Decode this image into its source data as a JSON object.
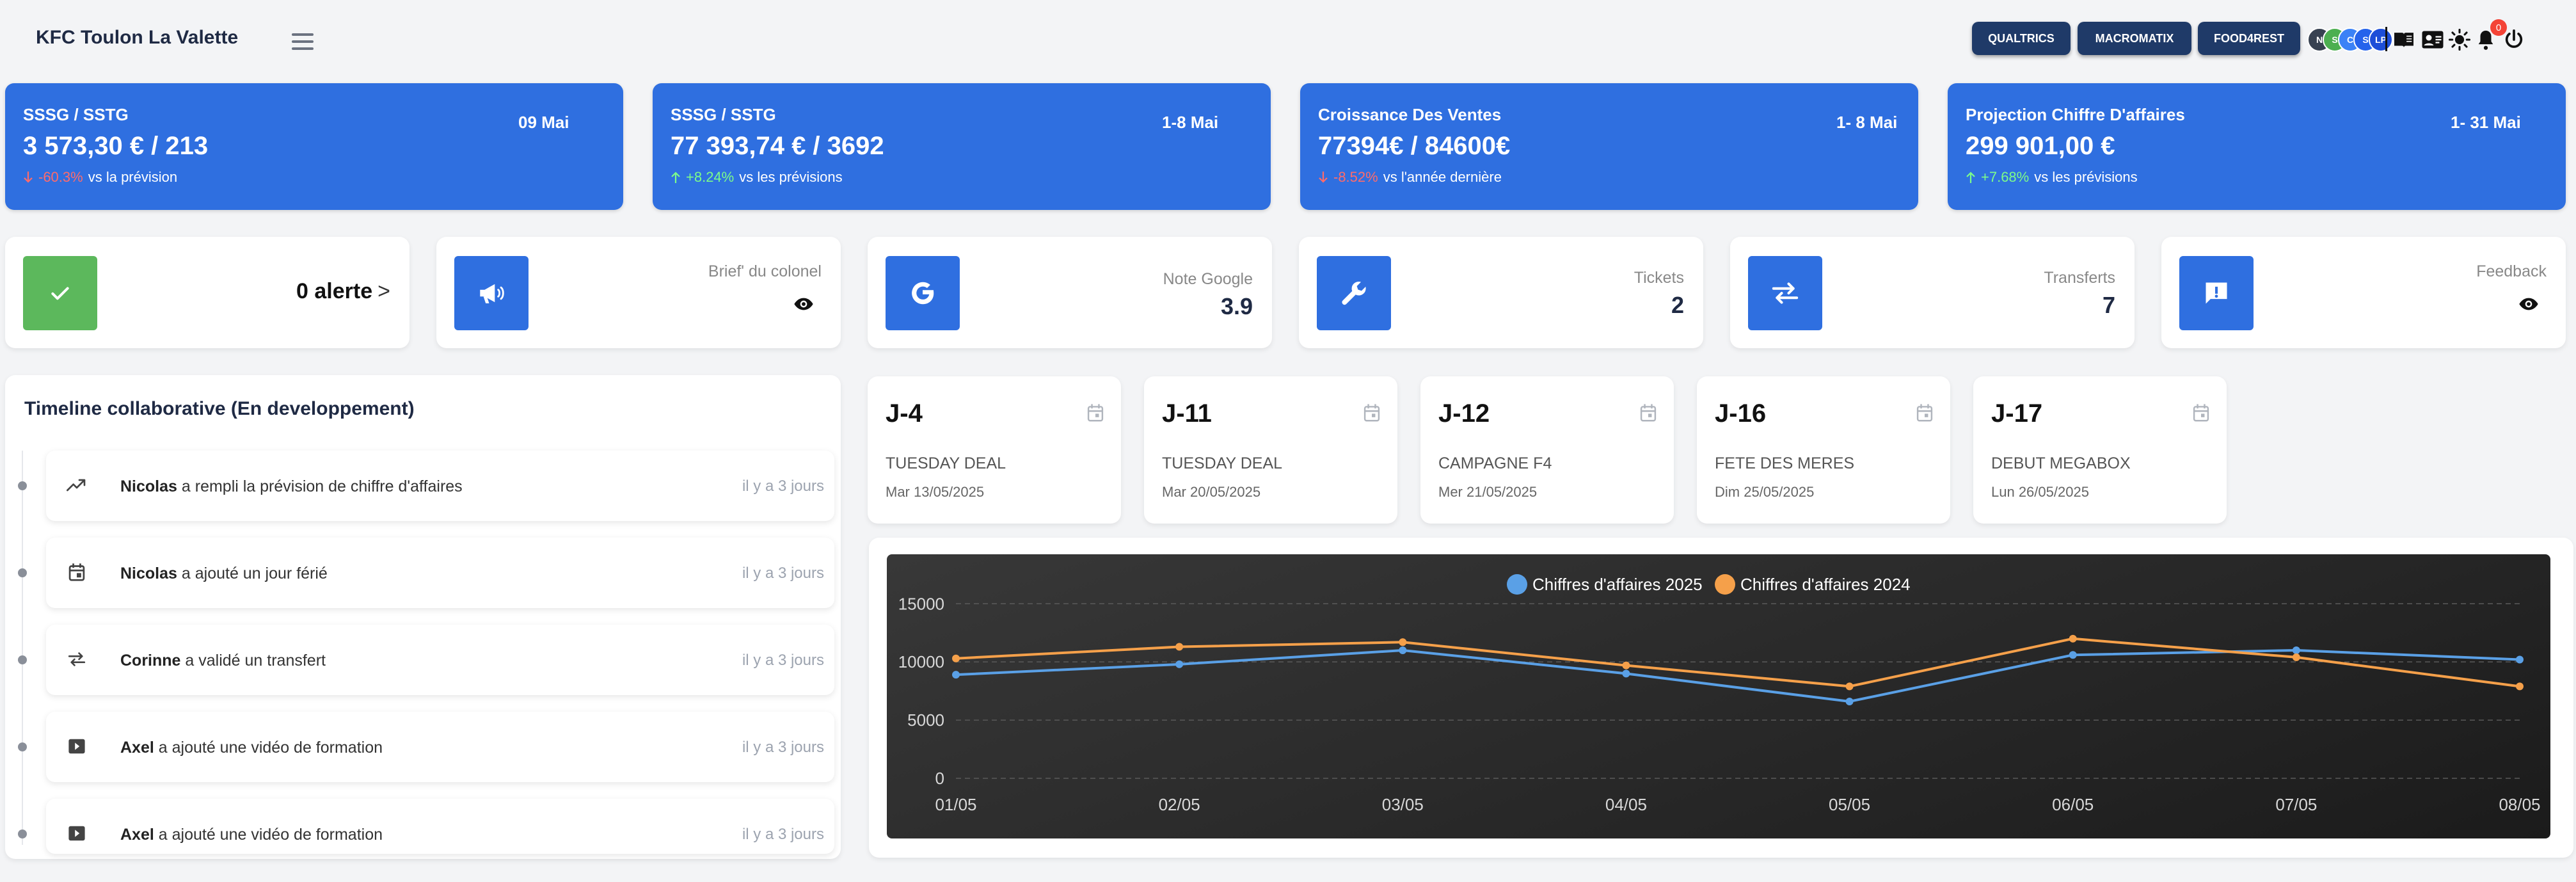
{
  "header": {
    "title": "KFC Toulon La Valette",
    "buttons": [
      "QUALTRICS",
      "MACROMATIX",
      "FOOD4REST"
    ],
    "avatars": [
      {
        "initials": "N",
        "color": "#374151"
      },
      {
        "initials": "S",
        "color": "#4caf50"
      },
      {
        "initials": "C",
        "color": "#3b82f6"
      },
      {
        "initials": "S",
        "color": "#2563eb"
      },
      {
        "initials": "LP",
        "color": "#1d4ed8"
      }
    ],
    "notification_count": "0"
  },
  "kpis": [
    {
      "title": "SSSG / SSTG",
      "date": "09 Mai",
      "value": "3 573,30 € / 213",
      "delta": "-60.3%",
      "direction": "down",
      "suffix": "vs la prévision"
    },
    {
      "title": "SSSG / SSTG",
      "date": "1-8 Mai",
      "value": "77 393,74 € / 3692",
      "delta": "+8.24%",
      "direction": "up",
      "suffix": "vs les prévisions"
    },
    {
      "title": "Croissance Des Ventes",
      "date": "1- 8 Mai",
      "value": "77394€ / 84600€",
      "delta": "-8.52%",
      "direction": "down",
      "suffix": "vs l'année dernière"
    },
    {
      "title": "Projection Chiffre D'affaires",
      "date": "1- 31 Mai",
      "value": "299 901,00 €",
      "delta": "+7.68%",
      "direction": "up",
      "suffix": "vs les prévisions"
    }
  ],
  "alerts": {
    "label": "0 alerte",
    "chevron": ">"
  },
  "tiles": [
    {
      "label": "Brief' du colonel",
      "value": "",
      "icon": "megaphone-icon"
    },
    {
      "label": "Note Google",
      "value": "3.9",
      "icon": "google-icon"
    },
    {
      "label": "Tickets",
      "value": "2",
      "icon": "wrench-icon"
    },
    {
      "label": "Transferts",
      "value": "7",
      "icon": "transfer-icon"
    },
    {
      "label": "Feedback",
      "value": "",
      "icon": "feedback-icon"
    }
  ],
  "timeline": {
    "title": "Timeline collaborative (En developpement)",
    "events": [
      {
        "user": "Nicolas",
        "text": "a rempli la prévision de chiffre d'affaires",
        "ago": "il y a 3 jours",
        "icon": "trending-up-icon"
      },
      {
        "user": "Nicolas",
        "text": "a ajouté un jour férié",
        "ago": "il y a 3 jours",
        "icon": "calendar-icon"
      },
      {
        "user": "Corinne",
        "text": "a validé un transfert",
        "ago": "il y a 3 jours",
        "icon": "transfer-icon"
      },
      {
        "user": "Axel",
        "text": "a ajouté une vidéo de formation",
        "ago": "il y a 3 jours",
        "icon": "video-icon"
      },
      {
        "user": "Axel",
        "text": "a ajouté une vidéo de formation",
        "ago": "il y a 3 jours",
        "icon": "video-icon"
      }
    ]
  },
  "events": [
    {
      "countdown": "J-4",
      "name": "TUESDAY DEAL",
      "date": "Mar 13/05/2025"
    },
    {
      "countdown": "J-11",
      "name": "TUESDAY DEAL",
      "date": "Mar 20/05/2025"
    },
    {
      "countdown": "J-12",
      "name": "CAMPAGNE F4",
      "date": "Mer 21/05/2025"
    },
    {
      "countdown": "J-16",
      "name": "FETE DES MERES",
      "date": "Dim 25/05/2025"
    },
    {
      "countdown": "J-17",
      "name": "DEBUT MEGABOX",
      "date": "Lun 26/05/2025"
    }
  ],
  "chart_data": {
    "type": "line",
    "categories": [
      "01/05",
      "02/05",
      "03/05",
      "04/05",
      "05/05",
      "06/05",
      "07/05",
      "08/05"
    ],
    "series": [
      {
        "name": "Chiffres d'affaires 2025",
        "color": "#5aa0e6",
        "values": [
          8900,
          9800,
          11000,
          9000,
          6600,
          10600,
          11000,
          10200
        ]
      },
      {
        "name": "Chiffres d'affaires 2024",
        "color": "#f5a04a",
        "values": [
          10300,
          11300,
          11700,
          9700,
          7900,
          12000,
          10400,
          7900
        ]
      }
    ],
    "yticks": [
      0,
      5000,
      10000,
      15000
    ],
    "ylim": [
      0,
      16500
    ],
    "grid": true,
    "legend": "top-center"
  }
}
